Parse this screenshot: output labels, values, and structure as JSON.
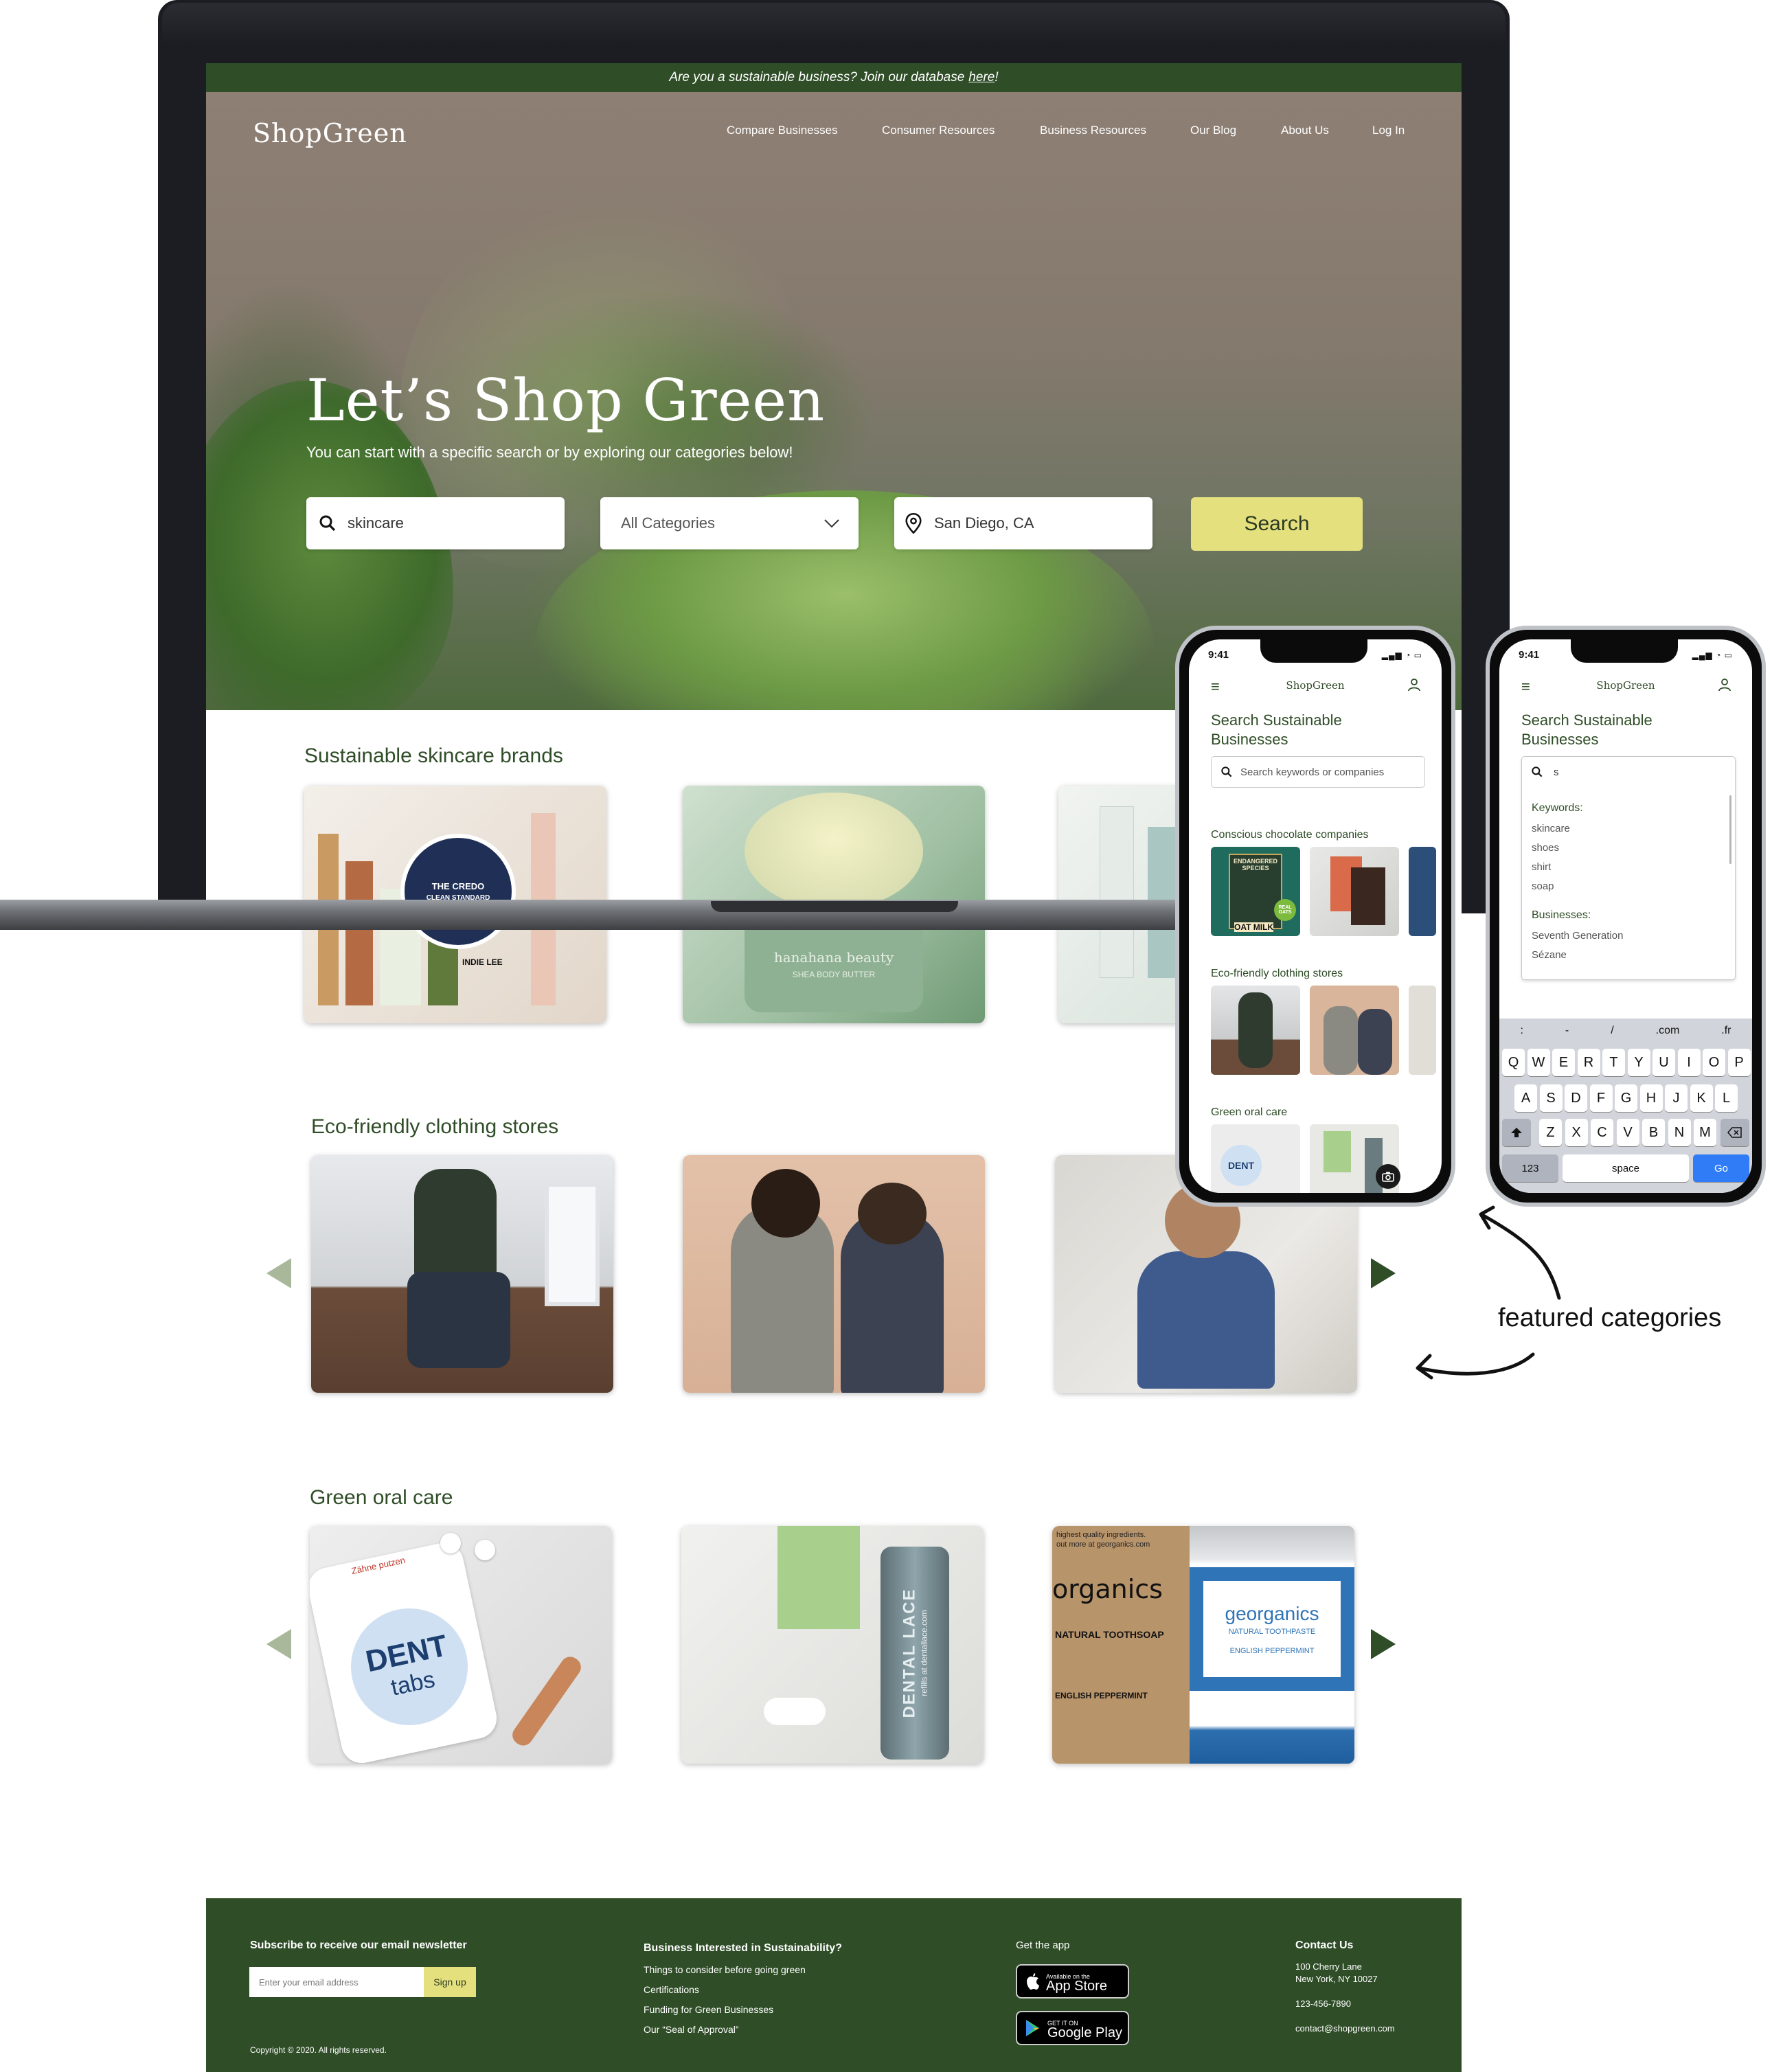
{
  "laptop": {
    "topbar": {
      "text": "Are you a sustainable business? Join our database",
      "link": "here",
      "end": "!"
    },
    "brand": "ShopGreen",
    "nav": [
      "Compare Businesses",
      "Consumer Resources",
      "Business Resources",
      "Our Blog",
      "About Us",
      "Log In"
    ],
    "hero": {
      "title": "Let’s Shop Green",
      "subtitle": "You can start with a specific search or by exploring our categories below!",
      "search_value": "skincare",
      "category_value": "All Categories",
      "location_value": "San Diego, CA",
      "search_button": "Search"
    },
    "sections": [
      {
        "title": "Sustainable skincare brands",
        "card_texts": [
          "THE CREDO",
          "CLEAN STANDARD",
          "INDIE LEE",
          "SHEA BODY BUTTER",
          "hanahana beauty"
        ]
      },
      {
        "title": "Eco-friendly clothing stores"
      },
      {
        "title": "Green oral care",
        "card_texts": [
          "Zähne putzen",
          "DENT",
          "tabs",
          "DENTAL LACE",
          "refills at dentallace.com",
          "organics",
          "NATURAL TOOTHSOAP",
          "ENGLISH PEPPERMINT",
          "georganics",
          "NATURAL TOOTHPASTE",
          "highest quality ingredients.",
          "out more at georganics.com"
        ]
      }
    ],
    "footer": {
      "newsletter_title": "Subscribe to receive our email newsletter",
      "email_placeholder": "Enter your email address",
      "signup_label": "Sign up",
      "copyright": "Copyright © 2020. All rights reserved.",
      "biz_title": "Business Interested in Sustainability?",
      "biz_links": [
        "Things to consider before going green",
        "Certifications",
        "Funding for Green Businesses",
        "Our “Seal of Approval”"
      ],
      "app_title": "Get the app",
      "appstore_small": "Available on the",
      "appstore_big": "App Store",
      "googleplay_small": "GET IT ON",
      "googleplay_big": "Google Play",
      "contact_title": "Contact Us",
      "address_line1": "100 Cherry Lane",
      "address_line2": "New York, NY 10027",
      "phone": "123-456-7890",
      "email": "contact@shopgreen.com"
    }
  },
  "phone1": {
    "time": "9:41",
    "brand": "ShopGreen",
    "title": "Search Sustainable Businesses",
    "search_placeholder": "Search keywords or companies",
    "categories": [
      "Conscious chocolate companies",
      "Eco-friendly clothing stores",
      "Green oral care"
    ],
    "thumb_texts": [
      "ENDANGERED SPECIES",
      "OAT MILK",
      "REAL OATS",
      "DENT"
    ]
  },
  "phone2": {
    "time": "9:41",
    "brand": "ShopGreen",
    "title": "Search Sustainable Businesses",
    "search_value": "s",
    "keywords_label": "Keywords:",
    "keywords": [
      "skincare",
      "shoes",
      "shirt",
      "soap"
    ],
    "businesses_label": "Businesses:",
    "businesses": [
      "Seventh Generation",
      "Sézane"
    ],
    "suggestions": [
      ":",
      "-",
      "/",
      ".com",
      ".fr"
    ],
    "row1": [
      "Q",
      "W",
      "E",
      "R",
      "T",
      "Y",
      "U",
      "I",
      "O",
      "P"
    ],
    "row2": [
      "A",
      "S",
      "D",
      "F",
      "G",
      "H",
      "J",
      "K",
      "L"
    ],
    "row3": [
      "Z",
      "X",
      "C",
      "V",
      "B",
      "N",
      "M"
    ],
    "key_123": "123",
    "key_space": "space",
    "key_go": "Go"
  },
  "annotation": "featured categories",
  "colors": {
    "brand_green": "#2f4d27",
    "search_yellow": "#e4e07e",
    "arrow_light": "#a9b79a"
  },
  "icons": [
    "search-icon",
    "chevron-down-icon",
    "location-pin-icon",
    "apple-icon",
    "google-play-icon",
    "menu-icon",
    "user-icon",
    "camera-icon",
    "shift-icon",
    "backspace-icon"
  ]
}
